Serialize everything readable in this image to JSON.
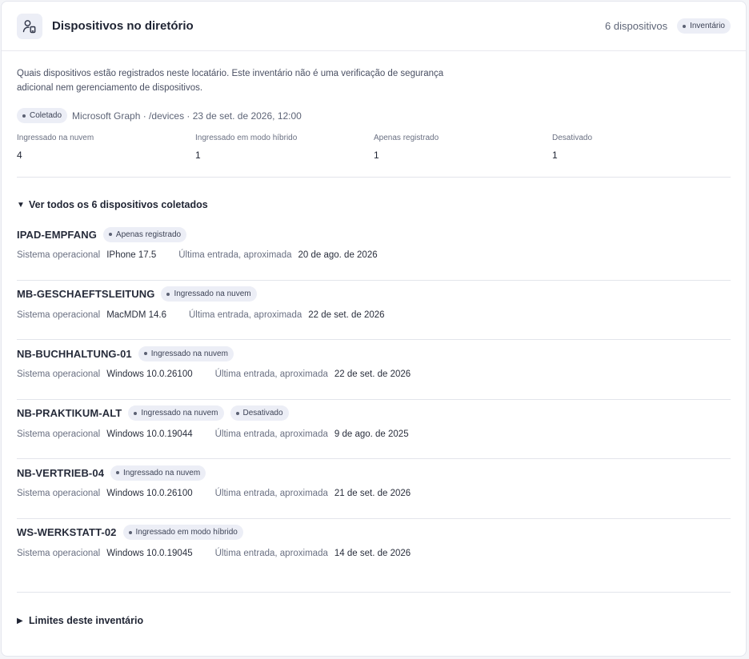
{
  "header": {
    "title": "Dispositivos no diretório",
    "count": "6 dispositivos",
    "badge": "Inventário",
    "icon": "user-device-icon"
  },
  "description": "Quais dispositivos estão registrados neste locatário. Este inventário não é uma verificação de segurança adicional nem gerenciamento de dispositivos.",
  "source": {
    "badge": "Coletado",
    "text": "Microsoft Graph · /devices · 23 de set. de 2026, 12:00"
  },
  "stats": [
    {
      "label": "Ingressado na nuvem",
      "value": "4"
    },
    {
      "label": "Ingressado em modo híbrido",
      "value": "1"
    },
    {
      "label": "Apenas registrado",
      "value": "1"
    },
    {
      "label": "Desativado",
      "value": "1"
    }
  ],
  "devices_section": {
    "summary": "Ver todos os 6 dispositivos coletados",
    "os_label": "Sistema operacional",
    "last_label": "Última entrada, aproximada",
    "items": [
      {
        "name": "IPAD-EMPFANG",
        "badges": [
          "Apenas registrado"
        ],
        "os": "IPhone 17.5",
        "last": "20 de ago. de 2026"
      },
      {
        "name": "MB-GESCHAEFTSLEITUNG",
        "badges": [
          "Ingressado na nuvem"
        ],
        "os": "MacMDM 14.6",
        "last": "22 de set. de 2026"
      },
      {
        "name": "NB-BUCHHALTUNG-01",
        "badges": [
          "Ingressado na nuvem"
        ],
        "os": "Windows 10.0.26100",
        "last": "22 de set. de 2026"
      },
      {
        "name": "NB-PRAKTIKUM-ALT",
        "badges": [
          "Ingressado na nuvem",
          "Desativado"
        ],
        "os": "Windows 10.0.19044",
        "last": "9 de ago. de 2025"
      },
      {
        "name": "NB-VERTRIEB-04",
        "badges": [
          "Ingressado na nuvem"
        ],
        "os": "Windows 10.0.26100",
        "last": "21 de set. de 2026"
      },
      {
        "name": "WS-WERKSTATT-02",
        "badges": [
          "Ingressado em modo híbrido"
        ],
        "os": "Windows 10.0.19045",
        "last": "14 de set. de 2026"
      }
    ]
  },
  "limits_section": {
    "summary": "Limites deste inventário"
  }
}
